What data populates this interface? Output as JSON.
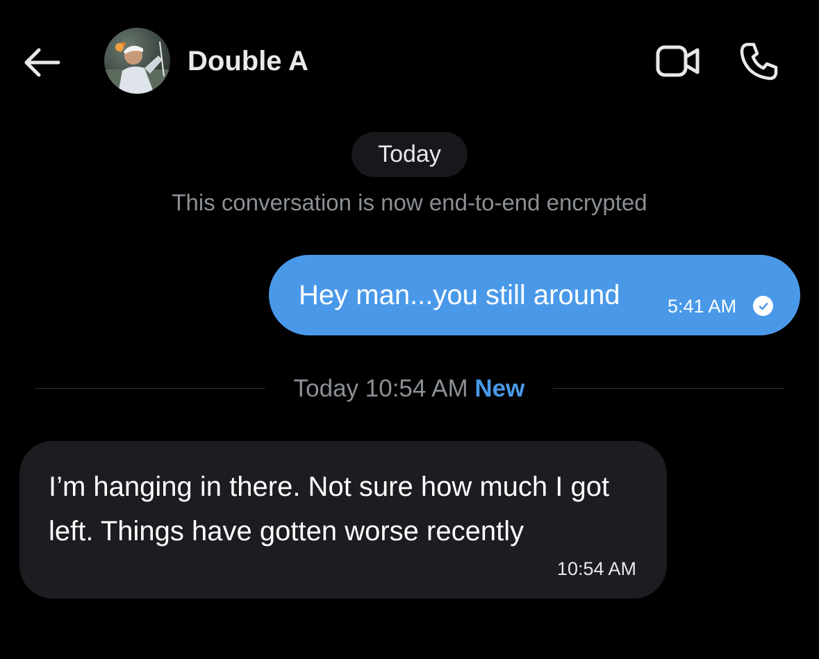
{
  "header": {
    "contact_name": "Double A",
    "back_icon": "arrow-left-icon",
    "video_icon": "video-camera-icon",
    "call_icon": "phone-icon"
  },
  "conversation": {
    "date_pill": "Today",
    "encryption_notice": "This conversation is now end-to-end encrypted",
    "messages": [
      {
        "direction": "outgoing",
        "text": "Hey man...you still around",
        "time": "5:41 AM",
        "status_icon": "read-check-icon"
      },
      {
        "direction": "incoming",
        "text": "I’m hanging in there. Not sure how much I got left. Things have gotten worse recently",
        "time": "10:54 AM"
      }
    ],
    "new_divider": {
      "time": "Today 10:54 AM",
      "badge": "New"
    }
  },
  "colors": {
    "background": "#000000",
    "outgoing_bubble": "#4a99e9",
    "incoming_bubble": "#1b1d21",
    "muted_text": "#8b9096",
    "accent": "#4a99e9"
  }
}
